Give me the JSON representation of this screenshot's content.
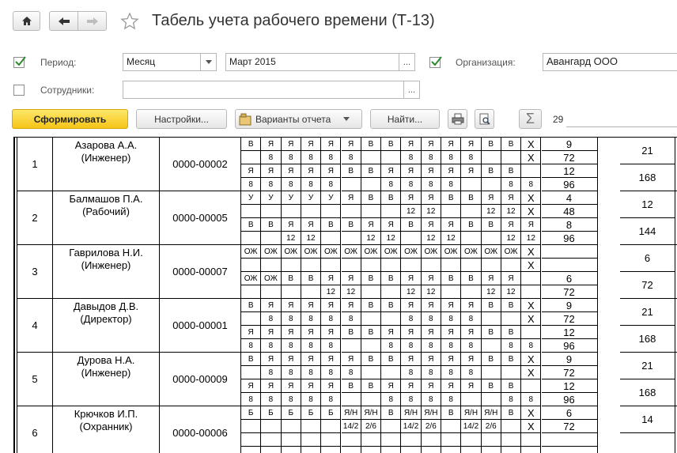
{
  "window": {
    "title": "Табель учета рабочего времени (Т-13)"
  },
  "filters": {
    "period_label": "Период:",
    "period_type": "Месяц",
    "period_value": "Март 2015",
    "org_label": "Организация:",
    "org_value": "Авангард ООО",
    "employees_label": "Сотрудники:",
    "employees_value": "",
    "period_checked": true,
    "org_checked": true,
    "employees_checked": false
  },
  "toolbar": {
    "generate": "Сформировать",
    "settings": "Настройки...",
    "variants": "Варианты отчета",
    "find": "Найти...",
    "sum_value": "29"
  },
  "ellipsis": "...",
  "employees": [
    {
      "num": "1",
      "name": "Азарова А.А.",
      "role": "(Инженер)",
      "tab": "0000-00002",
      "r1": [
        "В",
        "Я",
        "Я",
        "Я",
        "Я",
        "Я",
        "В",
        "В",
        "Я",
        "Я",
        "Я",
        "Я",
        "В",
        "В",
        "X"
      ],
      "r2": [
        "",
        "8",
        "8",
        "8",
        "8",
        "8",
        "",
        "",
        "8",
        "8",
        "8",
        "8",
        "",
        "",
        "X"
      ],
      "r3": [
        "Я",
        "Я",
        "Я",
        "Я",
        "Я",
        "В",
        "В",
        "Я",
        "Я",
        "Я",
        "Я",
        "Я",
        "В",
        "В",
        ""
      ],
      "r4": [
        "8",
        "8",
        "8",
        "8",
        "8",
        "",
        "",
        "8",
        "8",
        "8",
        "8",
        "",
        "",
        "8",
        "8"
      ],
      "t1": "9",
      "t2": "72",
      "t3": "12",
      "t4": "96",
      "s1": "21",
      "s2": "168"
    },
    {
      "num": "2",
      "name": "Балмашов П.А.",
      "role": "(Рабочий)",
      "tab": "0000-00005",
      "r1": [
        "У",
        "У",
        "У",
        "У",
        "У",
        "Я",
        "В",
        "В",
        "Я",
        "Я",
        "В",
        "В",
        "Я",
        "Я",
        "X"
      ],
      "r2": [
        "",
        "",
        "",
        "",
        "",
        "",
        "",
        "",
        "12",
        "12",
        "",
        "",
        "12",
        "12",
        "X"
      ],
      "r3": [
        "В",
        "В",
        "Я",
        "Я",
        "В",
        "В",
        "Я",
        "Я",
        "В",
        "Я",
        "Я",
        "В",
        "В",
        "Я",
        "Я"
      ],
      "r4": [
        "",
        "",
        "12",
        "12",
        "",
        "",
        "12",
        "12",
        "",
        "12",
        "12",
        "",
        "",
        "12",
        "12"
      ],
      "t1": "4",
      "t2": "48",
      "t3": "8",
      "t4": "96",
      "s1": "12",
      "s2": "144"
    },
    {
      "num": "3",
      "name": "Гаврилова Н.И.",
      "role": "(Инженер)",
      "tab": "0000-00007",
      "r1": [
        "ОЖ",
        "ОЖ",
        "ОЖ",
        "ОЖ",
        "ОЖ",
        "ОЖ",
        "ОЖ",
        "ОЖ",
        "ОЖ",
        "ОЖ",
        "ОЖ",
        "ОЖ",
        "ОЖ",
        "ОЖ",
        "X"
      ],
      "r2": [
        "",
        "",
        "",
        "",
        "",
        "",
        "",
        "",
        "",
        "",
        "",
        "",
        "",
        "",
        "X"
      ],
      "r3": [
        "ОЖ",
        "ОЖ",
        "В",
        "В",
        "Я",
        "Я",
        "В",
        "В",
        "Я",
        "Я",
        "В",
        "В",
        "Я",
        "Я",
        ""
      ],
      "r4": [
        "",
        "",
        "",
        "",
        "12",
        "12",
        "",
        "",
        "12",
        "12",
        "",
        "",
        "12",
        "12",
        ""
      ],
      "t1": "",
      "t2": "",
      "t3": "6",
      "t4": "72",
      "s1": "6",
      "s2": "72"
    },
    {
      "num": "4",
      "name": "Давыдов Д.В.",
      "role": "(Директор)",
      "tab": "0000-00001",
      "r1": [
        "В",
        "Я",
        "Я",
        "Я",
        "Я",
        "Я",
        "В",
        "В",
        "Я",
        "Я",
        "Я",
        "Я",
        "В",
        "В",
        "X"
      ],
      "r2": [
        "",
        "8",
        "8",
        "8",
        "8",
        "8",
        "",
        "",
        "8",
        "8",
        "8",
        "8",
        "",
        "",
        "X"
      ],
      "r3": [
        "Я",
        "Я",
        "Я",
        "Я",
        "Я",
        "В",
        "В",
        "Я",
        "Я",
        "Я",
        "Я",
        "Я",
        "В",
        "В",
        ""
      ],
      "r4": [
        "8",
        "8",
        "8",
        "8",
        "8",
        "",
        "",
        "8",
        "8",
        "8",
        "8",
        "8",
        "",
        "8",
        "8"
      ],
      "t1": "9",
      "t2": "72",
      "t3": "12",
      "t4": "96",
      "s1": "21",
      "s2": "168"
    },
    {
      "num": "5",
      "name": "Дурова Н.А.",
      "role": "(Инженер)",
      "tab": "0000-00009",
      "r1": [
        "В",
        "Я",
        "Я",
        "Я",
        "Я",
        "Я",
        "В",
        "В",
        "Я",
        "Я",
        "Я",
        "Я",
        "В",
        "В",
        "X"
      ],
      "r2": [
        "",
        "8",
        "8",
        "8",
        "8",
        "8",
        "",
        "",
        "8",
        "8",
        "8",
        "8",
        "",
        "",
        "X"
      ],
      "r3": [
        "Я",
        "Я",
        "Я",
        "Я",
        "Я",
        "В",
        "В",
        "Я",
        "Я",
        "Я",
        "Я",
        "Я",
        "В",
        "В",
        ""
      ],
      "r4": [
        "8",
        "8",
        "8",
        "8",
        "8",
        "",
        "",
        "8",
        "8",
        "8",
        "8",
        "",
        "",
        "8",
        "8"
      ],
      "t1": "9",
      "t2": "72",
      "t3": "12",
      "t4": "96",
      "s1": "21",
      "s2": "168"
    },
    {
      "num": "6",
      "name": "Крючков И.П.",
      "role": "(Охранник)",
      "tab": "0000-00006",
      "r1": [
        "Б",
        "Б",
        "Б",
        "Б",
        "Б",
        "Я/Н",
        "Я/Н",
        "В",
        "Я/Н",
        "Я/Н",
        "В",
        "Я/Н",
        "Я/Н",
        "В",
        "X"
      ],
      "r2": [
        "",
        "",
        "",
        "",
        "",
        "14/2",
        "2/6",
        "",
        "14/2",
        "2/6",
        "",
        "14/2",
        "2/6",
        "",
        "X"
      ],
      "r3": [
        "",
        "",
        "",
        "",
        "",
        "",
        "",
        "",
        "",
        "",
        "",
        "",
        "",
        "",
        ""
      ],
      "r4": [
        "",
        "",
        "",
        "",
        "",
        "",
        "",
        "",
        "",
        "",
        "",
        "",
        "",
        "",
        ""
      ],
      "t1": "6",
      "t2": "72",
      "t3": "",
      "t4": "",
      "s1": "14",
      "s2": ""
    }
  ]
}
